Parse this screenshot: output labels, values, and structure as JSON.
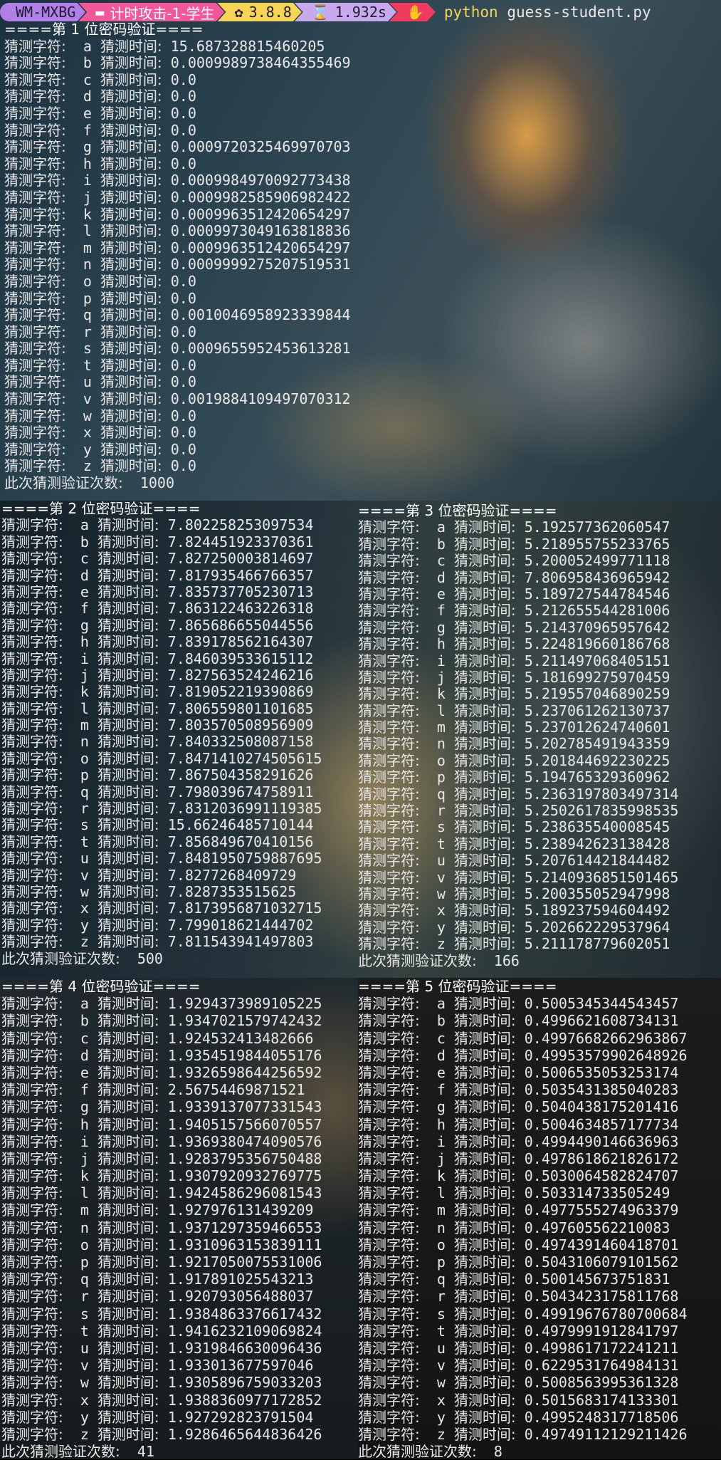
{
  "statusbar": {
    "host": "WM-MXBG",
    "dir": "计时攻击-1-学生",
    "python_version": "3.8.8",
    "duration": "1.932s",
    "command": "python",
    "script": "guess-student.py"
  },
  "labels": {
    "char": "猜测字符:",
    "time": "猜测时间:",
    "count": "此次猜测验证次数:"
  },
  "blocks": [
    {
      "header": "====第 1 位密码验证====",
      "rows": [
        [
          "a",
          "15.687328815460205"
        ],
        [
          "b",
          "0.0009989738464355469"
        ],
        [
          "c",
          "0.0"
        ],
        [
          "d",
          "0.0"
        ],
        [
          "e",
          "0.0"
        ],
        [
          "f",
          "0.0"
        ],
        [
          "g",
          "0.0009720325469970703"
        ],
        [
          "h",
          "0.0"
        ],
        [
          "i",
          "0.0009984970092773438"
        ],
        [
          "j",
          "0.0009982585906982422"
        ],
        [
          "k",
          "0.0009963512420654297"
        ],
        [
          "l",
          "0.0009973049163818836"
        ],
        [
          "m",
          "0.0009963512420654297"
        ],
        [
          "n",
          "0.0009999275207519531"
        ],
        [
          "o",
          "0.0"
        ],
        [
          "p",
          "0.0"
        ],
        [
          "q",
          "0.0010046958923339844"
        ],
        [
          "r",
          "0.0"
        ],
        [
          "s",
          "0.0009655952453613281"
        ],
        [
          "t",
          "0.0"
        ],
        [
          "u",
          "0.0"
        ],
        [
          "v",
          "0.0019884109497070312"
        ],
        [
          "w",
          "0.0"
        ],
        [
          "x",
          "0.0"
        ],
        [
          "y",
          "0.0"
        ],
        [
          "z",
          "0.0"
        ]
      ],
      "count": "1000"
    },
    {
      "header": "====第 2 位密码验证====",
      "rows": [
        [
          "a",
          "7.802258253097534"
        ],
        [
          "b",
          "7.824451923370361"
        ],
        [
          "c",
          "7.827250003814697"
        ],
        [
          "d",
          "7.817935466766357"
        ],
        [
          "e",
          "7.835737705230713"
        ],
        [
          "f",
          "7.863122463226318"
        ],
        [
          "g",
          "7.865686655044556"
        ],
        [
          "h",
          "7.839178562164307"
        ],
        [
          "i",
          "7.846039533615112"
        ],
        [
          "j",
          "7.827563524246216"
        ],
        [
          "k",
          "7.819052219390869"
        ],
        [
          "l",
          "7.806559801101685"
        ],
        [
          "m",
          "7.803570508956909"
        ],
        [
          "n",
          "7.840332508087158"
        ],
        [
          "o",
          "7.8471410274505615"
        ],
        [
          "p",
          "7.867504358291626"
        ],
        [
          "q",
          "7.798039674758911"
        ],
        [
          "r",
          "7.8312036991119385"
        ],
        [
          "s",
          "15.66246485710144"
        ],
        [
          "t",
          "7.856849670410156"
        ],
        [
          "u",
          "7.8481950759887695"
        ],
        [
          "v",
          "7.8277268409729"
        ],
        [
          "w",
          "7.8287353515625"
        ],
        [
          "x",
          "7.8173956871032715"
        ],
        [
          "y",
          "7.799018621444702"
        ],
        [
          "z",
          "7.811543941497803"
        ]
      ],
      "count": "500"
    },
    {
      "header": "====第 3 位密码验证====",
      "rows": [
        [
          "a",
          "5.192577362060547"
        ],
        [
          "b",
          "5.218955755233765"
        ],
        [
          "c",
          "5.200052499771118"
        ],
        [
          "d",
          "7.806958436965942"
        ],
        [
          "e",
          "5.189727544784546"
        ],
        [
          "f",
          "5.212655544281006"
        ],
        [
          "g",
          "5.214370965957642"
        ],
        [
          "h",
          "5.224819660186768"
        ],
        [
          "i",
          "5.211497068405151"
        ],
        [
          "j",
          "5.181699275970459"
        ],
        [
          "k",
          "5.219557046890259"
        ],
        [
          "l",
          "5.237061262130737"
        ],
        [
          "m",
          "5.237012624740601"
        ],
        [
          "n",
          "5.202785491943359"
        ],
        [
          "o",
          "5.201844692230225"
        ],
        [
          "p",
          "5.194765329360962"
        ],
        [
          "q",
          "5.2363197803497314"
        ],
        [
          "r",
          "5.2502617835998535"
        ],
        [
          "s",
          "5.238635540008545"
        ],
        [
          "t",
          "5.238942623138428"
        ],
        [
          "u",
          "5.207614421844482"
        ],
        [
          "v",
          "5.2140936851501465"
        ],
        [
          "w",
          "5.200355052947998"
        ],
        [
          "x",
          "5.189237594604492"
        ],
        [
          "y",
          "5.202662229537964"
        ],
        [
          "z",
          "5.211178779602051"
        ]
      ],
      "count": "166"
    },
    {
      "header": "====第 4 位密码验证====",
      "rows": [
        [
          "a",
          "1.9294373989105225"
        ],
        [
          "b",
          "1.9347021579742432"
        ],
        [
          "c",
          "1.924532413482666"
        ],
        [
          "d",
          "1.9354519844055176"
        ],
        [
          "e",
          "1.9326598644256592"
        ],
        [
          "f",
          "2.56754469871521"
        ],
        [
          "g",
          "1.9339137077331543"
        ],
        [
          "h",
          "1.9405157566070557"
        ],
        [
          "i",
          "1.9369380474090576"
        ],
        [
          "j",
          "1.9283795356750488"
        ],
        [
          "k",
          "1.9307920932769775"
        ],
        [
          "l",
          "1.9424586296081543"
        ],
        [
          "m",
          "1.927976131439209"
        ],
        [
          "n",
          "1.9371297359466553"
        ],
        [
          "o",
          "1.9310963153839111"
        ],
        [
          "p",
          "1.9217050075531006"
        ],
        [
          "q",
          "1.917891025543213"
        ],
        [
          "r",
          "1.920793056488037"
        ],
        [
          "s",
          "1.9384863376617432"
        ],
        [
          "t",
          "1.9416232109069824"
        ],
        [
          "u",
          "1.9319846630096436"
        ],
        [
          "v",
          "1.933013677597046"
        ],
        [
          "w",
          "1.9305896759033203"
        ],
        [
          "x",
          "1.9388360977172852"
        ],
        [
          "y",
          "1.927292823791504"
        ],
        [
          "z",
          "1.9286465644836426"
        ]
      ],
      "count": "41"
    },
    {
      "header": "====第 5 位密码验证====",
      "rows": [
        [
          "a",
          "0.5005345344543457"
        ],
        [
          "b",
          "0.4996621608734131"
        ],
        [
          "c",
          "0.49976682662963867"
        ],
        [
          "d",
          "0.49953579902648926"
        ],
        [
          "e",
          "0.5006535053253174"
        ],
        [
          "f",
          "0.5035431385040283"
        ],
        [
          "g",
          "0.5040438175201416"
        ],
        [
          "h",
          "0.5004634857177734"
        ],
        [
          "i",
          "0.4994490146636963"
        ],
        [
          "j",
          "0.4978618621826172"
        ],
        [
          "k",
          "0.5030064582824707"
        ],
        [
          "l",
          "0.503314733505249"
        ],
        [
          "m",
          "0.4977555274963379"
        ],
        [
          "n",
          "0.497605562210083"
        ],
        [
          "o",
          "0.4974391460418701"
        ],
        [
          "p",
          "0.5043106079101562"
        ],
        [
          "q",
          "0.500145673751831"
        ],
        [
          "r",
          "0.5043423175811768"
        ],
        [
          "s",
          "0.49919676780700684"
        ],
        [
          "t",
          "0.4979991912841797"
        ],
        [
          "u",
          "0.4998617172241211"
        ],
        [
          "v",
          "0.6229531764984131"
        ],
        [
          "w",
          "0.5008563995361328"
        ],
        [
          "x",
          "0.5015683174133301"
        ],
        [
          "y",
          "0.4995248317718506"
        ],
        [
          "z",
          "0.49749112129211426"
        ]
      ],
      "count": "8"
    }
  ]
}
